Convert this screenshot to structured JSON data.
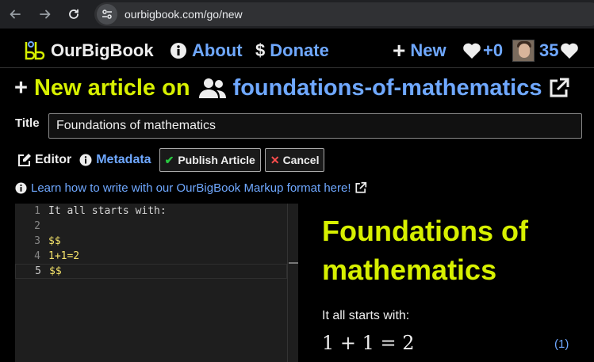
{
  "browser": {
    "url": "ourbigbook.com/go/new"
  },
  "navbar": {
    "brand": "OurBigBook",
    "about": "About",
    "donate": "Donate",
    "new": "New",
    "likes": "+0",
    "user_score": "35"
  },
  "page": {
    "title_lead": "New article on",
    "topic": "foundations-of-mathematics",
    "title_label": "Title",
    "title_value": "Foundations of mathematics",
    "tabs": {
      "editor": "Editor",
      "metadata": "Metadata"
    },
    "buttons": {
      "publish": "Publish Article",
      "cancel": "Cancel"
    },
    "help_text": "Learn how to write with our OurBigBook Markup format here!"
  },
  "editor": {
    "lines": [
      {
        "num": "1",
        "text": "It all starts with:"
      },
      {
        "num": "2",
        "text": ""
      },
      {
        "num": "3",
        "text": "$$"
      },
      {
        "num": "4",
        "text": "1+1=2"
      },
      {
        "num": "5",
        "text": "$$"
      }
    ]
  },
  "preview": {
    "heading": "Foundations of mathematics",
    "paragraph": "It all starts with:",
    "math": "1 + 1 = 2",
    "equation_number": "(1)"
  },
  "colors": {
    "accent_yellow": "#d7f000",
    "link_blue": "#6fa8ff",
    "publish_check": "#28c840",
    "cancel_x": "#ff4d4d"
  }
}
